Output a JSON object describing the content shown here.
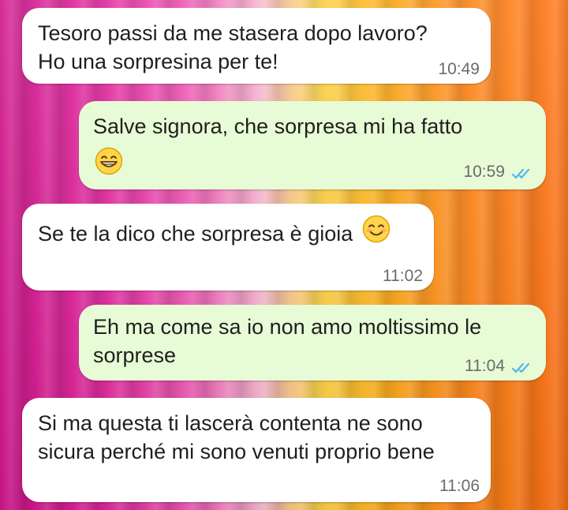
{
  "conversation": {
    "messages": [
      {
        "direction": "incoming",
        "lines": [
          "Tesoro passi da me stasera dopo lavoro?",
          "Ho una sorpresina per te!"
        ],
        "time": "10:49"
      },
      {
        "direction": "outgoing",
        "lines": [
          "Salve signora, che sorpresa mi ha fatto"
        ],
        "emoji": "grinning-face-with-smiling-eyes",
        "time": "10:59",
        "status": "read"
      },
      {
        "direction": "incoming",
        "lines": [
          "Se te la dico che sorpresa è gioia"
        ],
        "emoji": "smiling-face-with-smiling-eyes",
        "time": "11:02"
      },
      {
        "direction": "outgoing",
        "lines": [
          "Eh ma come sa io non amo moltissimo le",
          "sorprese"
        ],
        "time": "11:04",
        "status": "read"
      },
      {
        "direction": "incoming",
        "lines": [
          "Si ma questa ti lascerà contenta ne sono",
          "sicura perché mi sono venuti proprio bene"
        ],
        "time": "11:06"
      }
    ]
  },
  "colors": {
    "incoming_bubble": "#ffffff",
    "outgoing_bubble": "#e7fbd6",
    "read_ticks": "#4fb6ec",
    "timestamp": "#6b6b6b"
  },
  "icons": [
    "read-receipt-icon",
    "grinning-emoji-icon",
    "smiling-emoji-icon"
  ]
}
